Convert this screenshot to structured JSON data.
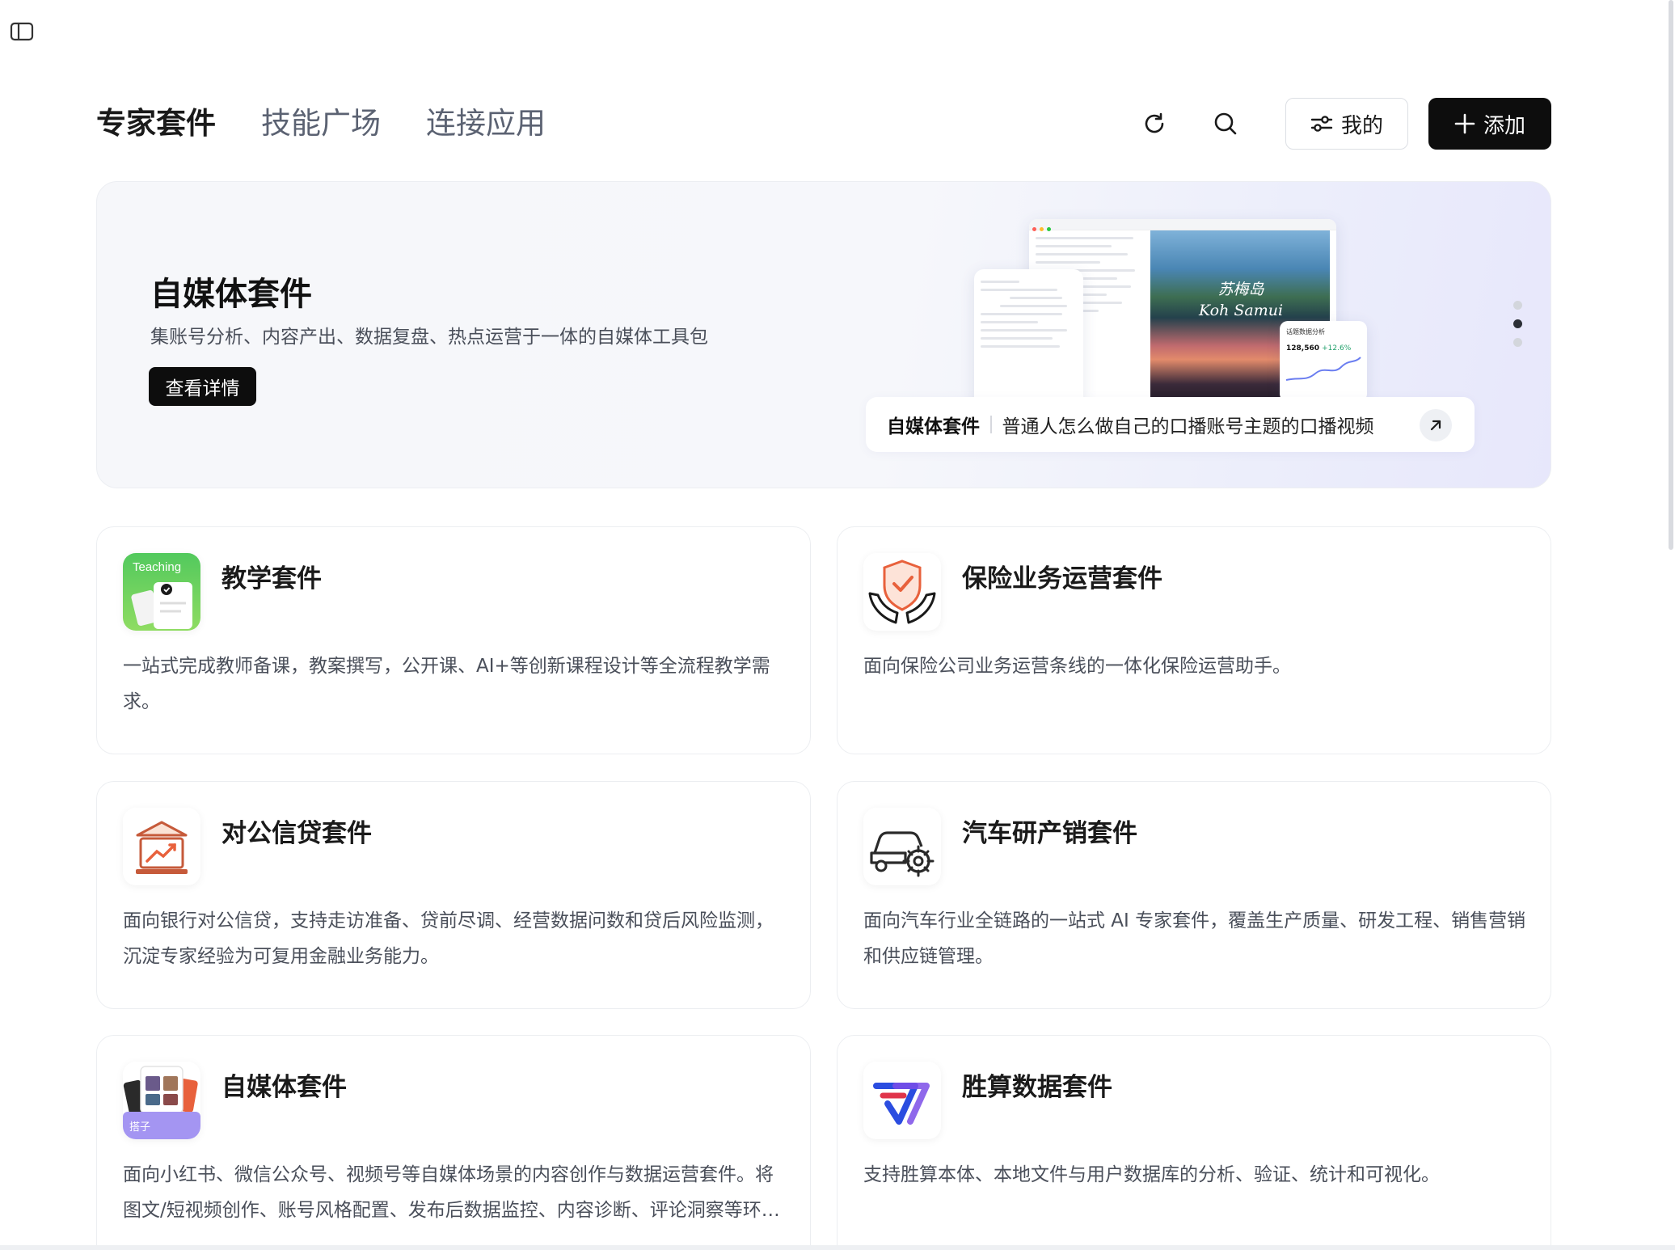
{
  "tabs": [
    {
      "label": "专家套件",
      "active": true
    },
    {
      "label": "技能广场",
      "active": false
    },
    {
      "label": "连接应用",
      "active": false
    }
  ],
  "actions": {
    "refresh_icon": "refresh-icon",
    "search_icon": "search-icon",
    "mine_label": "我的",
    "add_label": "添加"
  },
  "hero": {
    "title": "自媒体套件",
    "subtitle": "集账号分析、内容产出、数据复盘、热点运营于一体的自媒体工具包",
    "button": "查看详情",
    "preview_photo_text_line1": "苏梅岛",
    "preview_photo_text_line2": "Koh Samui",
    "preview_stats_label": "话题数据分析",
    "preview_stats_value": "128,560",
    "preview_stats_delta": "+12.6%",
    "pill_tag": "自媒体套件",
    "pill_text": "普通人怎么做自己的口播账号主题的口播视频",
    "pager_active_index": 1,
    "pager_count": 3
  },
  "cards": [
    {
      "title": "教学套件",
      "icon": "teaching-icon",
      "icon_text": "Teaching",
      "desc": "一站式完成教师备课，教案撰写，公开课、AI+等创新课程设计等全流程教学需求。"
    },
    {
      "title": "保险业务运营套件",
      "icon": "insurance-shield-icon",
      "desc": "面向保险公司业务运营条线的一体化保险运营助手。"
    },
    {
      "title": "对公信贷套件",
      "icon": "bank-credit-icon",
      "desc": "面向银行对公信贷，支持走访准备、贷前尽调、经营数据问数和贷后风险监测，沉淀专家经验为可复用金融业务能力。"
    },
    {
      "title": "汽车研产销套件",
      "icon": "car-gear-icon",
      "desc": "面向汽车行业全链路的一站式 AI 专家套件，覆盖生产质量、研发工程、销售营销和供应链管理。"
    },
    {
      "title": "自媒体套件",
      "icon": "media-cards-icon",
      "icon_text": "搭子",
      "desc": "面向小红书、微信公众号、视频号等自媒体场景的内容创作与数据运营套件。将图文/短视频创作、账号风格配置、发布后数据监控、内容诊断、评论洞察等环节打通，形成完整的内容运营闭环。"
    },
    {
      "title": "胜算数据套件",
      "icon": "shengsuan-logo-icon",
      "desc": "支持胜算本体、本地文件与用户数据库的分析、验证、统计和可视化。"
    }
  ],
  "colors": {
    "accent_black": "#0d0d0d",
    "teaching_green": "#4cc25a",
    "insurance_orange": "#e8613c",
    "media_purple": "#9a8ef0",
    "shengsuan_blue": "#2b4de0"
  }
}
